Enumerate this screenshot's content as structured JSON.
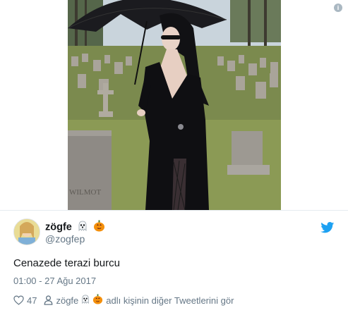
{
  "tweet": {
    "display_name": "zögfe",
    "handle": "@zogfep",
    "text": "Cenazede terazi burcu",
    "timestamp": "01:00 - 27 Ağu 2017",
    "like_count": "47",
    "footer_name": "zögfe",
    "footer_link_text": "adlı kişinin diğer Tweetlerini gör",
    "name_emojis": [
      "ghost-icon",
      "jack-o-lantern-icon"
    ]
  },
  "photo": {
    "tombstone_engraving": "WILMOT"
  },
  "colors": {
    "twitter_blue": "#1da1f2",
    "secondary_text": "#657786",
    "primary_text": "#14171a"
  },
  "icons": [
    "info-icon",
    "twitter-bird-icon",
    "heart-icon",
    "person-icon",
    "ghost-icon",
    "jack-o-lantern-icon"
  ]
}
